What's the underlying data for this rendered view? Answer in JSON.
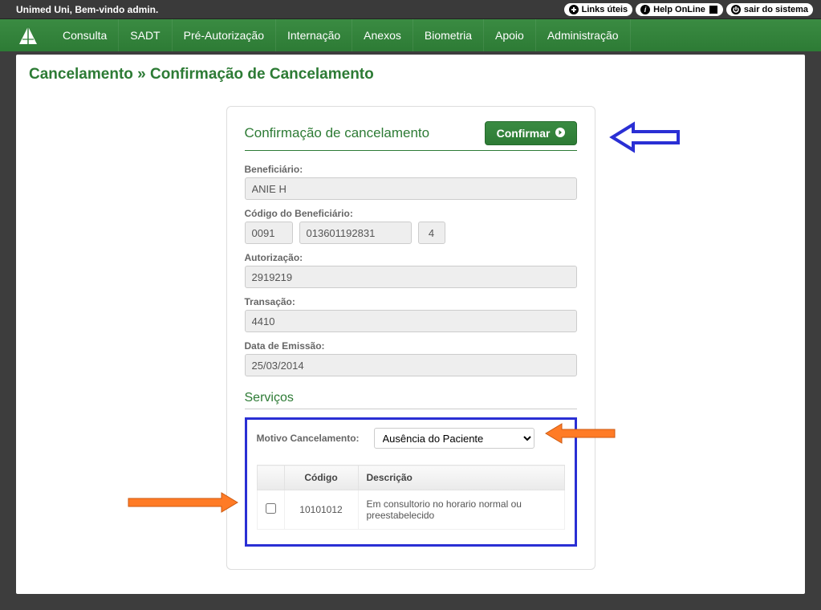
{
  "topbar": {
    "welcome": "Unimed Uni, Bem-vindo admin.",
    "links_uteis": "Links úteis",
    "help_online": "Help OnLine",
    "sair": "sair do sistema"
  },
  "nav": {
    "items": [
      {
        "label": "Consulta"
      },
      {
        "label": "SADT"
      },
      {
        "label": "Pré-Autorização"
      },
      {
        "label": "Internação"
      },
      {
        "label": "Anexos"
      },
      {
        "label": "Biometria"
      },
      {
        "label": "Apoio"
      },
      {
        "label": "Administração"
      }
    ]
  },
  "breadcrumb": "Cancelamento » Confirmação de Cancelamento",
  "panel": {
    "title": "Confirmação de cancelamento",
    "confirm_label": "Confirmar",
    "beneficiario_label": "Beneficiário:",
    "beneficiario_value": "ANIE H",
    "codigo_benef_label": "Código do Beneficiário:",
    "codigo_benef_prefix": "0091",
    "codigo_benef_num": "013601192831",
    "codigo_benef_digit": "4",
    "autorizacao_label": "Autorização:",
    "autorizacao_value": "2919219",
    "transacao_label": "Transação:",
    "transacao_value": "4410",
    "data_emissao_label": "Data de Emissão:",
    "data_emissao_value": "25/03/2014",
    "servicos_title": "Serviços",
    "motivo_label": "Motivo Cancelamento:",
    "motivo_value": "Ausência do Paciente",
    "table": {
      "h_codigo": "Código",
      "h_descricao": "Descrição",
      "rows": [
        {
          "codigo": "10101012",
          "descricao": "Em consultorio no horario normal ou preestabelecido"
        }
      ]
    }
  }
}
